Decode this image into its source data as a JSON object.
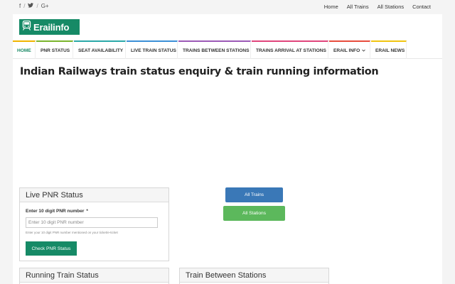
{
  "topbar": {
    "social": [
      {
        "name": "facebook",
        "glyph": "f"
      },
      {
        "name": "twitter",
        "glyph": "🐦"
      },
      {
        "name": "google-plus",
        "glyph": "G+"
      }
    ],
    "links": [
      "Home",
      "All Trains",
      "All Stations",
      "Contact"
    ]
  },
  "logo": {
    "text": "Erailinfo"
  },
  "nav": {
    "items": [
      {
        "label": "HOME",
        "accent": "#f0b400"
      },
      {
        "label": "PNR STATUS",
        "accent": "#7ab42c"
      },
      {
        "label": "SEAT AVAILABILITY",
        "accent": "#2aa8a8"
      },
      {
        "label": "LIVE TRAIN STATUS",
        "accent": "#3a8fd6"
      },
      {
        "label": "TRAINS BETWEEN STATIONS",
        "accent": "#9b59b6"
      },
      {
        "label": "TRAINS ARRIVAL AT STATIONS",
        "accent": "#e0457b"
      },
      {
        "label": "ERAIL INFO",
        "accent": "#e74c3c"
      },
      {
        "label": "ERAIL NEWS",
        "accent": "#f1c40f"
      }
    ]
  },
  "page": {
    "title": "Indian Railways train status enquiry & train running information"
  },
  "pnr_panel": {
    "title": "Live PNR Status",
    "label": "Enter 10 digit PNR number",
    "required": "*",
    "placeholder": "Enter 10 digit PNR number",
    "help": "Enter your 10 digit PNR number mentioned on your ticket/e-ticket",
    "button": "Check PNR Status"
  },
  "buttons": {
    "all_trains": "All Trains",
    "all_stations": "All Stations"
  },
  "running_panel": {
    "title": "Running Train Status"
  },
  "between_panel": {
    "title": "Train Between Stations"
  },
  "colors": {
    "brand": "#168a66",
    "blue_button": "#3a78b7",
    "green_button": "#5cb85c"
  }
}
